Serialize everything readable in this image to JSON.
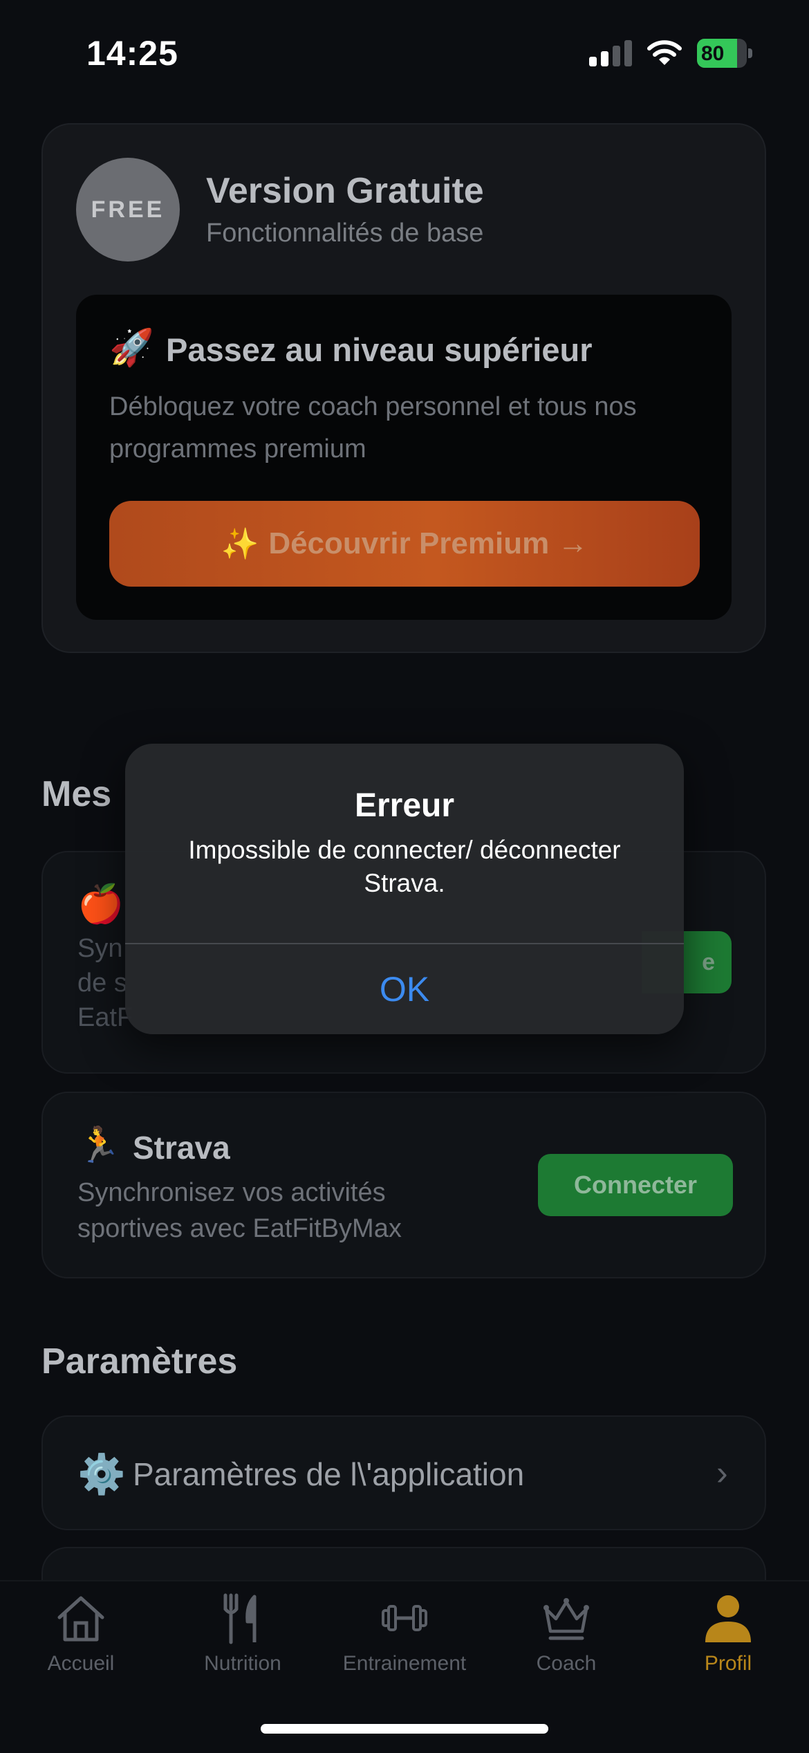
{
  "status_bar": {
    "time": "14:25",
    "battery": "80",
    "battery_level": 0.8
  },
  "plan_card": {
    "badge": "FREE",
    "title": "Version Gratuite",
    "subtitle": "Fonctionnalités de base",
    "upsell": {
      "icon": "🚀",
      "title": "Passez au niveau supérieur",
      "description": "Débloquez votre coach personnel et tous nos programmes premium",
      "button_icon": "✨",
      "button_label": "Découvrir Premium →"
    }
  },
  "section_connections": {
    "title": "Mes",
    "app1": {
      "icon": "🍎",
      "line1": "Syn",
      "line2": "de s",
      "line3": "EatF",
      "button_fragment": "e"
    },
    "strava": {
      "icon": "🏃",
      "title": "Strava",
      "description": "Synchronisez vos activités sportives avec EatFitByMax",
      "button": "Connecter"
    }
  },
  "section_settings": {
    "title": "Paramètres",
    "item": {
      "icon": "⚙️",
      "label": "Paramètres de l\\'application",
      "chevron": "›"
    }
  },
  "tabbar": {
    "items": [
      {
        "label": "Accueil",
        "icon": "home-icon"
      },
      {
        "label": "Nutrition",
        "icon": "fork-knife-icon"
      },
      {
        "label": "Entrainement",
        "icon": "dumbbell-icon"
      },
      {
        "label": "Coach",
        "icon": "crown-icon"
      },
      {
        "label": "Profil",
        "icon": "person-icon"
      }
    ],
    "active_color": "#b8861a"
  },
  "alert": {
    "title": "Erreur",
    "message": "Impossible de connecter/ déconnecter Strava.",
    "ok": "OK"
  }
}
